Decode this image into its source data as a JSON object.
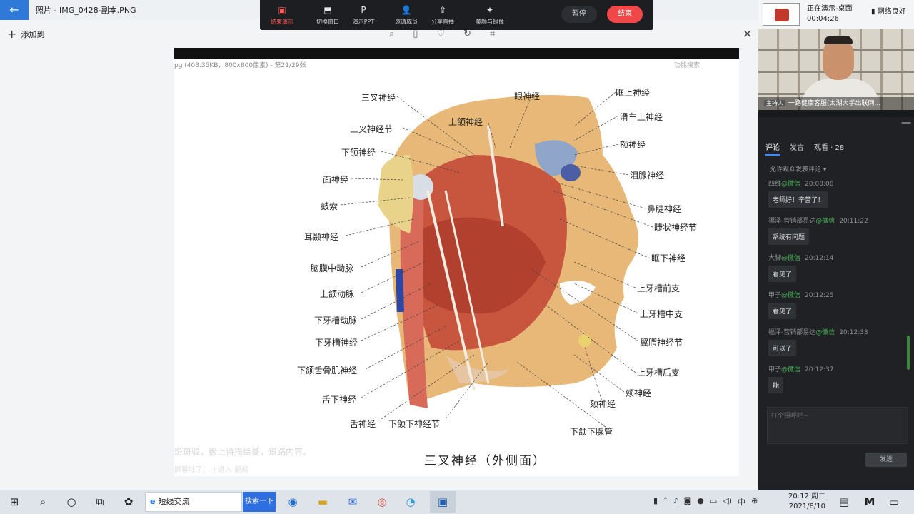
{
  "photo_app": {
    "back_icon": "←",
    "title": "照片 - IMG_0428-副本.PNG",
    "add_to_label": "添加到",
    "tools": [
      "zoom-icon",
      "delete-icon",
      "heart-icon",
      "rotate-icon",
      "crop-icon"
    ],
    "close_icon": "✕"
  },
  "shared_image": {
    "info": "pg (403.35KB，800x800像素) - 第21/29张",
    "func_search": "功能搜索",
    "bottom_text_1": "斑斑驳，嵌上诗描绘蔓，道路内容。",
    "bottom_text_2": "屏幕吐了(—)  进入 翻阅"
  },
  "diagram": {
    "title": "三叉神经（外侧面）",
    "labels_left": [
      "三叉神经",
      "三叉神经节",
      "下颌神经",
      "面神经",
      "鼓索",
      "耳颞神经",
      "脑膜中动脉",
      "上颌动脉",
      "下牙槽动脉",
      "下牙槽神经",
      "下颌舌骨肌神经",
      "舌下神经",
      "舌神经",
      "下颌下神经节"
    ],
    "labels_top": [
      "上颌神经",
      "眼神经"
    ],
    "labels_right": [
      "眶上神经",
      "滑车上神经",
      "额神经",
      "泪腺神经",
      "鼻睫神经",
      "睫状神经节",
      "眶下神经",
      "上牙槽前支",
      "上牙槽中支",
      "翼腭神经节",
      "上牙槽后支",
      "颊神经",
      "颏神经",
      "下颌下腺管"
    ]
  },
  "presenter_bar": {
    "buttons": [
      {
        "label": "结束演示",
        "icon": "▣"
      },
      {
        "label": "切换窗口",
        "icon": "⬒"
      },
      {
        "label": "演示PPT",
        "icon": "P"
      },
      {
        "label": "邀请成员",
        "icon": "👤"
      },
      {
        "label": "分享直播",
        "icon": "⇪"
      },
      {
        "label": "美颜与镜像",
        "icon": "✦"
      }
    ],
    "pause_label": "暂停",
    "finish_label": "结束"
  },
  "right_panel": {
    "status_line1": "正在演示-桌面",
    "status_time": "00:04:26",
    "network": "网络良好",
    "host_tag": "主持人",
    "cam_caption": "一路健康客服(太湖大学出联网...",
    "tabs": [
      "评论",
      "发言",
      "观看 · 28"
    ],
    "allow_text": "允许观众发表评论 ▾",
    "comments": [
      {
        "name": "四维",
        "at": "@微信",
        "time": "20:08:08",
        "text": "老师好！辛苦了！"
      },
      {
        "name": "福泽-营销部易达",
        "at": "@微信",
        "time": "20:11:22",
        "text": "系统有问题"
      },
      {
        "name": "大脚",
        "at": "@微信",
        "time": "20:12:14",
        "text": "看见了"
      },
      {
        "name": "甲子",
        "at": "@微信",
        "time": "20:12:25",
        "text": "看见了"
      },
      {
        "name": "福泽-营销部易达",
        "at": "@微信",
        "time": "20:12:33",
        "text": "可以了"
      },
      {
        "name": "甲子",
        "at": "@微信",
        "time": "20:12:37",
        "text": "能"
      }
    ],
    "input_placeholder": "打个招呼吧~",
    "send_label": "发送",
    "minimize_icon": "—"
  },
  "taskbar": {
    "search_text": "短线交流",
    "search_button": "搜索一下",
    "clock_time": "20:12 周二",
    "clock_date": "2021/8/10",
    "tray_input": "中"
  }
}
